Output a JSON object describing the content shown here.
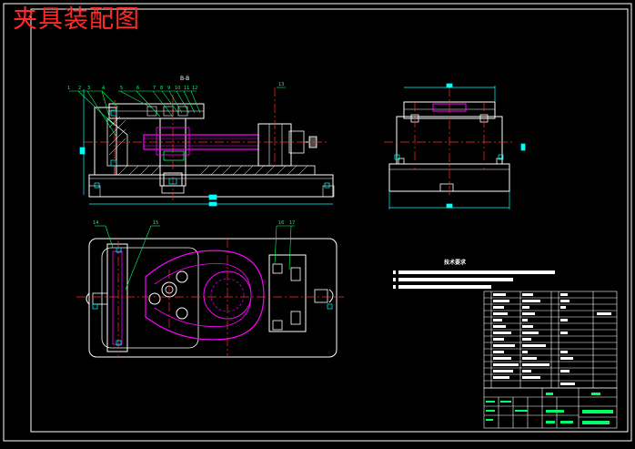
{
  "drawing": {
    "title": "夹具装配图",
    "section_label": "B-B",
    "leader_labels": [
      "1",
      "2",
      "3",
      "4",
      "5",
      "6",
      "7",
      "8",
      "9",
      "10",
      "11",
      "12",
      "13",
      "14",
      "15",
      "16",
      "17"
    ],
    "tech_requirements_title": "技术要求"
  },
  "colors": {
    "background": "#000000",
    "frame": "#ffffff",
    "outline": "#ffffff",
    "centerline": "#ff3030",
    "part": "#ff00ff",
    "dimension": "#00ffff",
    "leader": "#00ff66",
    "title_red": "#ff2a2a"
  }
}
